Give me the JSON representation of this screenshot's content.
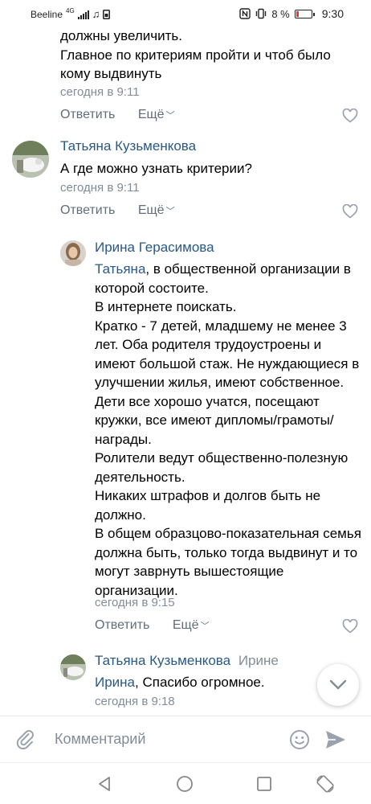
{
  "status_bar": {
    "carrier": "Beeline",
    "network": "4G",
    "battery_percent": "8 %",
    "time": "9:30"
  },
  "comments": [
    {
      "paragraphs": [
        "должны увеличить.",
        "Главное по критериям пройти и чтоб было кому выдвинуть"
      ],
      "date": "сегодня в 9:11",
      "reply_label": "Ответить",
      "more_label": "Ещё"
    },
    {
      "author": "Татьяна Кузьменкова",
      "paragraphs": [
        "А где можно узнать критерии?"
      ],
      "date": "сегодня в 9:11",
      "reply_label": "Ответить",
      "more_label": "Ещё"
    },
    {
      "author": "Ирина Герасимова",
      "mention": "Татьяна",
      "first_text": ", в общественной организации в которой состоите.",
      "paragraphs": [
        "В интернете поискать.",
        "Кратко - 7 детей, младшему не менее 3 лет. Оба родителя трудоустроены и имеют большой стаж. Не нуждающиеся в улучшении жилья, имеют собственное. Дети все хорошо учатся, посещают кружки, все имеют дипломы/грамоты/награды.",
        "Ролители ведут общественно-полезную деятельность.",
        "Никаких штрафов и долгов быть не должно.",
        "В общем образцово-показательная семья должна быть, только тогда выдвинут и то могут заврнуть вышестоящие организации."
      ],
      "date": "сегодня в 9:15",
      "reply_label": "Ответить",
      "more_label": "Ещё"
    },
    {
      "author": "Татьяна Кузьменкова",
      "reply_to": "Ирине",
      "mention": "Ирина",
      "first_text": ", Спасибо огромное.",
      "date": "сегодня в 9:18"
    }
  ],
  "composer": {
    "placeholder": "Комментарий"
  },
  "icons": {
    "like": "heart-outline-icon",
    "more": "chevron-down-icon",
    "attach": "paperclip-icon",
    "emoji": "smiley-icon",
    "send": "send-icon",
    "scroll": "chevron-down-icon",
    "nav_back": "triangle-back-icon",
    "nav_home": "circle-home-icon",
    "nav_recents": "square-recents-icon",
    "nav_rotate": "rotate-icon"
  },
  "colors": {
    "link": "#2a5885",
    "secondary": "#818c99",
    "action": "#626d7a",
    "icon": "#99a2ad"
  }
}
